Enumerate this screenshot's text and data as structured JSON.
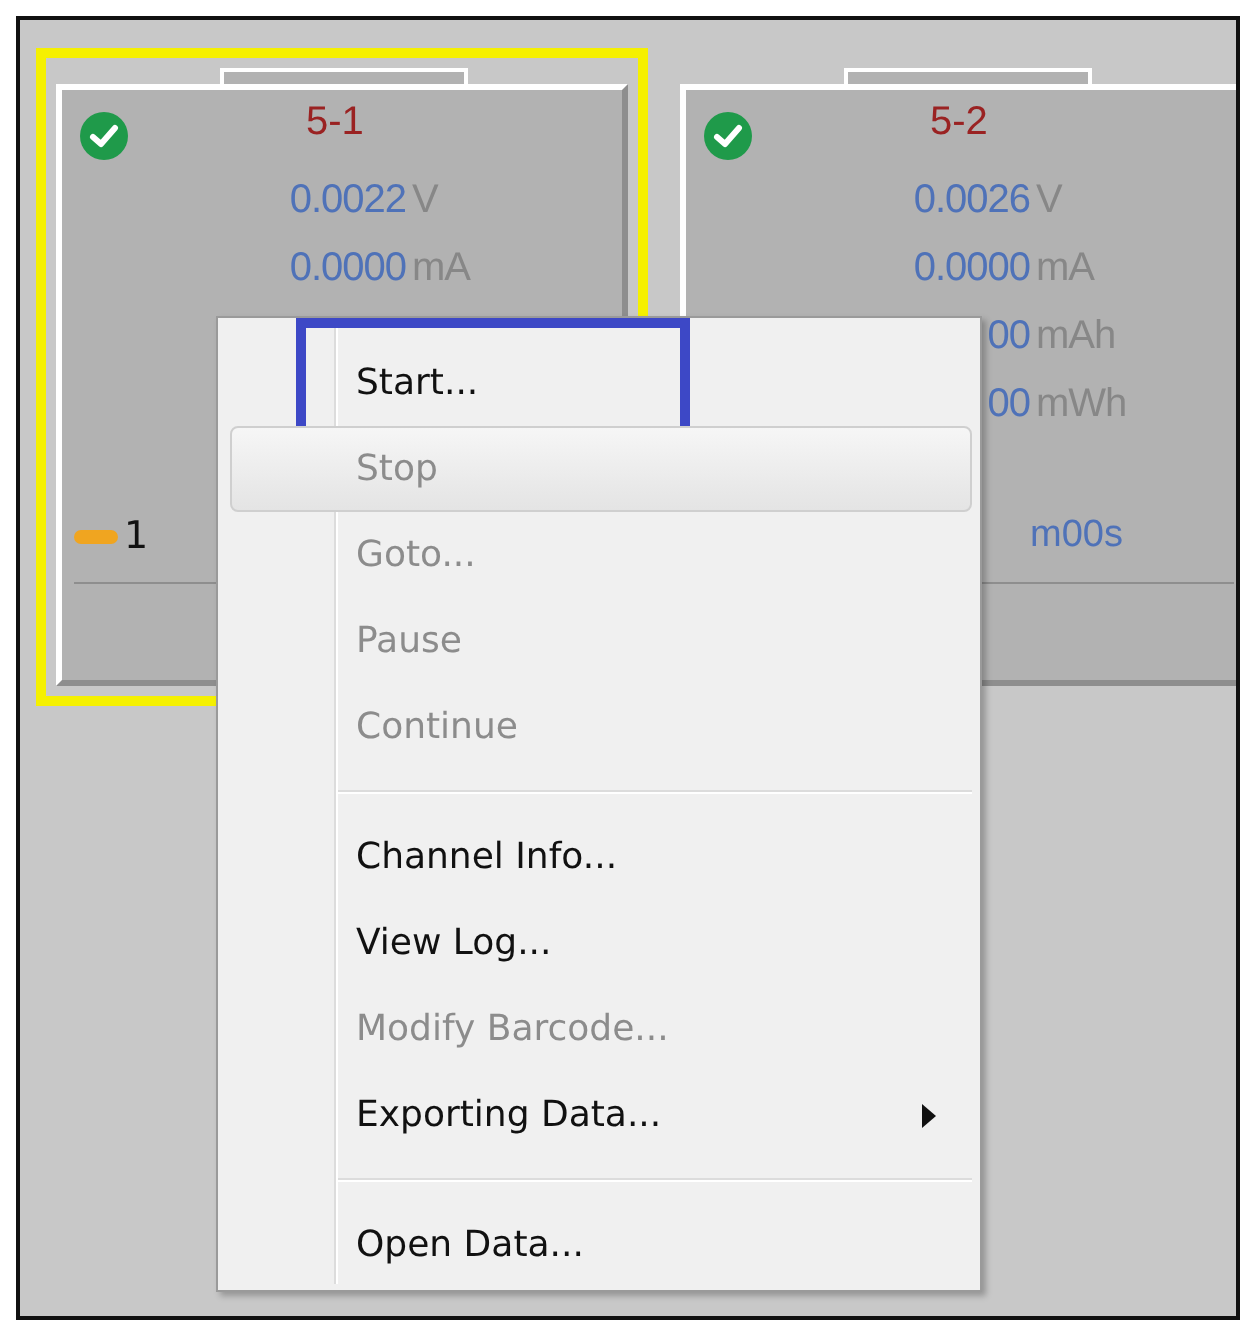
{
  "channels": [
    {
      "title": "5-1",
      "selected": true,
      "ok": true,
      "readings": [
        {
          "value": "0.0022",
          "unit": "V"
        },
        {
          "value": "0.0000",
          "unit": "mA"
        }
      ],
      "step": "1"
    },
    {
      "title": "5-2",
      "selected": false,
      "ok": true,
      "readings": [
        {
          "value": "0.0026",
          "unit": "V"
        },
        {
          "value": "0.0000",
          "unit": "mA"
        },
        {
          "value": "00",
          "unit": "mAh"
        },
        {
          "value": "00",
          "unit": "mWh"
        }
      ],
      "elapsed": "m00s"
    }
  ],
  "context_menu": {
    "items": [
      {
        "kind": "item",
        "label": "Start...",
        "disabled": false,
        "hovered": false,
        "framed": true,
        "submenu": false
      },
      {
        "kind": "item",
        "label": "Stop",
        "disabled": true,
        "hovered": true,
        "framed": false,
        "submenu": false
      },
      {
        "kind": "item",
        "label": "Goto...",
        "disabled": true,
        "hovered": false,
        "framed": false,
        "submenu": false
      },
      {
        "kind": "item",
        "label": "Pause",
        "disabled": true,
        "hovered": false,
        "framed": false,
        "submenu": false
      },
      {
        "kind": "item",
        "label": "Continue",
        "disabled": true,
        "hovered": false,
        "framed": false,
        "submenu": false
      },
      {
        "kind": "separator"
      },
      {
        "kind": "item",
        "label": "Channel Info...",
        "disabled": false,
        "hovered": false,
        "framed": false,
        "submenu": false
      },
      {
        "kind": "item",
        "label": "View Log...",
        "disabled": false,
        "hovered": false,
        "framed": false,
        "submenu": false
      },
      {
        "kind": "item",
        "label": "Modify Barcode...",
        "disabled": true,
        "hovered": false,
        "framed": false,
        "submenu": false
      },
      {
        "kind": "item",
        "label": "Exporting Data...",
        "disabled": false,
        "hovered": false,
        "framed": false,
        "submenu": true
      },
      {
        "kind": "separator"
      },
      {
        "kind": "item",
        "label": "Open Data...",
        "disabled": false,
        "hovered": false,
        "framed": false,
        "submenu": false
      }
    ]
  }
}
